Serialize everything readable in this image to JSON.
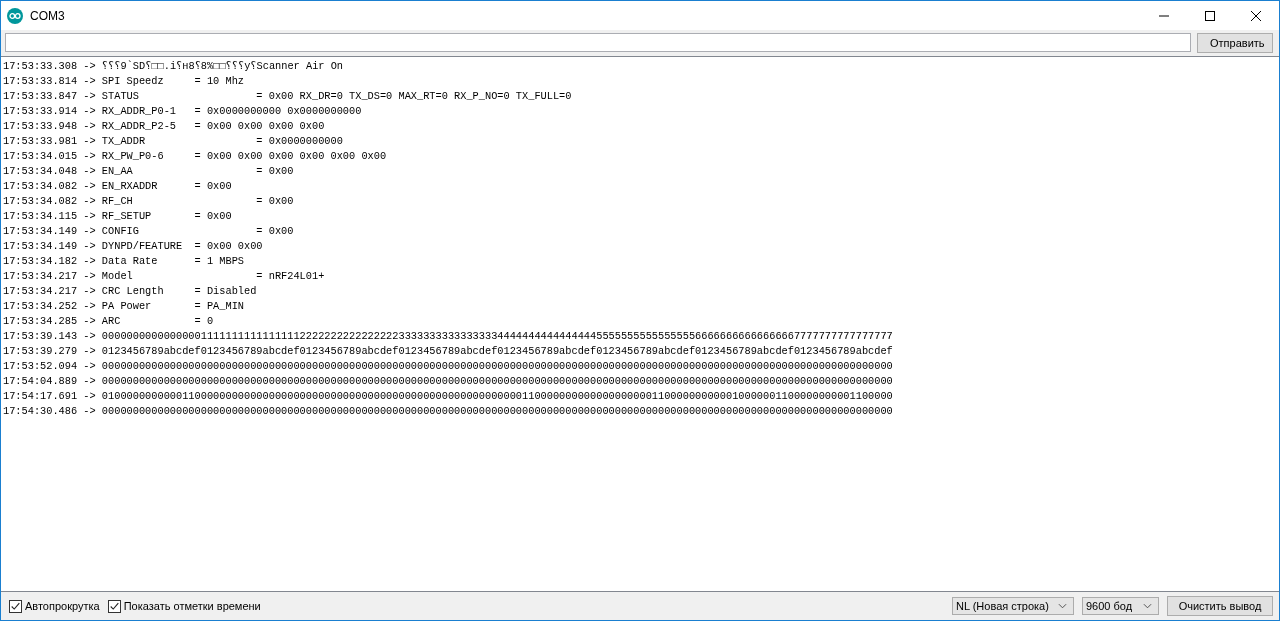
{
  "window": {
    "title": "COM3"
  },
  "send": {
    "button": "Отправить"
  },
  "log": [
    "17:53:33.308 -> ⸮⸮⸮9`SD⸮□□.i⸮н8⸮8%□□⸮⸮⸮y⸮Scanner Air On",
    "17:53:33.814 -> SPI Speedz     = 10 Mhz",
    "17:53:33.847 -> STATUS                   = 0x00 RX_DR=0 TX_DS=0 MAX_RT=0 RX_P_NO=0 TX_FULL=0",
    "17:53:33.914 -> RX_ADDR_P0-1   = 0x0000000000 0x0000000000",
    "17:53:33.948 -> RX_ADDR_P2-5   = 0x00 0x00 0x00 0x00",
    "17:53:33.981 -> TX_ADDR                  = 0x0000000000",
    "17:53:34.015 -> RX_PW_P0-6     = 0x00 0x00 0x00 0x00 0x00 0x00",
    "17:53:34.048 -> EN_AA                    = 0x00",
    "17:53:34.082 -> EN_RXADDR      = 0x00",
    "17:53:34.082 -> RF_CH                    = 0x00",
    "17:53:34.115 -> RF_SETUP       = 0x00",
    "17:53:34.149 -> CONFIG                   = 0x00",
    "17:53:34.149 -> DYNPD/FEATURE  = 0x00 0x00",
    "17:53:34.182 -> Data Rate      = 1 MBPS",
    "17:53:34.217 -> Model                    = nRF24L01+",
    "17:53:34.217 -> CRC Length     = Disabled",
    "17:53:34.252 -> PA Power       = PA_MIN",
    "17:53:34.285 -> ARC            = 0",
    "17:53:39.143 -> 00000000000000001111111111111111222222222222222233333333333333334444444444444444555555555555555566666666666666667777777777777777",
    "17:53:39.279 -> 0123456789abcdef0123456789abcdef0123456789abcdef0123456789abcdef0123456789abcdef0123456789abcdef0123456789abcdef0123456789abcdef",
    "17:53:52.094 -> 00000000000000000000000000000000000000000000000000000000000000000000000000000000000000000000000000000000000000000000000000000000",
    "17:54:04.889 -> 00000000000000000000000000000000000000000000000000000000000000000000000000000000000000000000000000000000000000000000000000000000",
    "17:54:17.691 -> 01000000000001100000000000000000000000000000000000000000000000000000110000000000000000000110000000000010000001100000000001100000",
    "17:54:30.486 -> 00000000000000000000000000000000000000000000000000000000000000000000000000000000000000000000000000000000000000000000000000000000"
  ],
  "footer": {
    "autoscroll": {
      "label": "Автопрокрутка",
      "checked": true
    },
    "timestamps": {
      "label": "Показать отметки времени",
      "checked": true
    },
    "line_ending": "NL (Новая строка)",
    "baud": "9600 бод",
    "clear_button": "Очистить вывод"
  }
}
